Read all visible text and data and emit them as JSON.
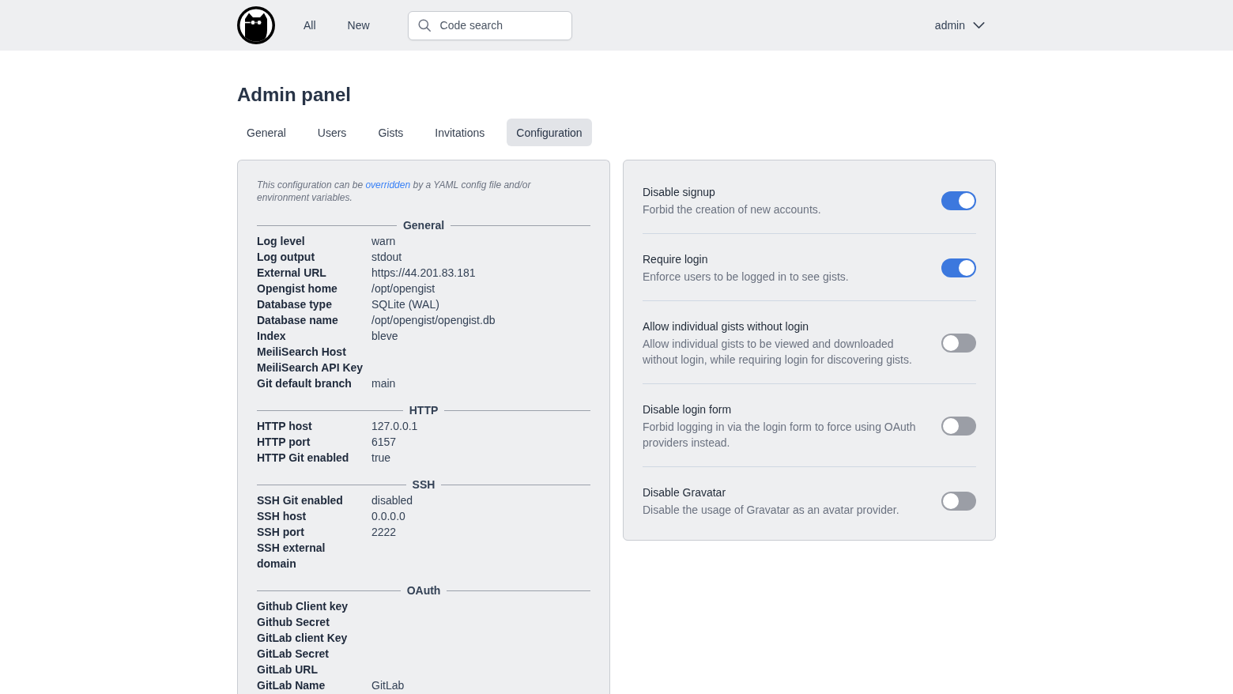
{
  "header": {
    "nav": [
      {
        "label": "All"
      },
      {
        "label": "New"
      }
    ],
    "search": {
      "placeholder": "Code search"
    },
    "user_menu": {
      "label": "admin"
    }
  },
  "page": {
    "title": "Admin panel"
  },
  "tabs": [
    {
      "label": "General",
      "selected": false
    },
    {
      "label": "Users",
      "selected": false
    },
    {
      "label": "Gists",
      "selected": false
    },
    {
      "label": "Invitations",
      "selected": false
    },
    {
      "label": "Configuration",
      "selected": true
    }
  ],
  "config_panel": {
    "note": {
      "before": "This configuration can be",
      "link": "overridden",
      "after": "by a YAML config file and/or environment variables."
    },
    "sections": [
      {
        "title": "General",
        "rows": [
          {
            "label": "Log level",
            "value": "warn"
          },
          {
            "label": "Log output",
            "value": "stdout"
          },
          {
            "label": "External URL",
            "value": "https://44.201.83.181"
          },
          {
            "label": "Opengist home",
            "value": "/opt/opengist"
          },
          {
            "label": "Database type",
            "value": "SQLite (WAL)"
          },
          {
            "label": "Database name",
            "value": "/opt/opengist/opengist.db"
          },
          {
            "label": "Index",
            "value": "bleve"
          },
          {
            "label": "MeiliSearch Host"
          },
          {
            "label": "MeiliSearch API Key"
          },
          {
            "label": "Git default branch",
            "value": "main"
          }
        ]
      },
      {
        "title": "HTTP",
        "rows": [
          {
            "label": "HTTP host",
            "value": "127.0.0.1"
          },
          {
            "label": "HTTP port",
            "value": "6157"
          },
          {
            "label": "HTTP Git enabled",
            "value": "true"
          }
        ]
      },
      {
        "title": "SSH",
        "rows": [
          {
            "label": "SSH Git enabled",
            "value": "disabled"
          },
          {
            "label": "SSH host",
            "value": "0.0.0.0"
          },
          {
            "label": "SSH port",
            "value": "2222"
          },
          {
            "label": "SSH external domain"
          }
        ]
      },
      {
        "title": "OAuth",
        "rows": [
          {
            "label": "Github Client key"
          },
          {
            "label": "Github Secret"
          },
          {
            "label": "GitLab client Key"
          },
          {
            "label": "GitLab Secret"
          },
          {
            "label": "GitLab URL"
          },
          {
            "label": "GitLab Name",
            "value": "GitLab"
          }
        ]
      }
    ]
  },
  "settings": [
    {
      "title": "Disable signup",
      "description": "Forbid the creation of new accounts.",
      "on": true
    },
    {
      "title": "Require login",
      "description": "Enforce users to be logged in to see gists.",
      "on": true
    },
    {
      "title": "Allow individual gists without login",
      "description": "Allow individual gists to be viewed and downloaded without login, while requiring login for discovering gists.",
      "on": false
    },
    {
      "title": "Disable login form",
      "description": "Forbid logging in via the login form to force using OAuth providers instead.",
      "on": false
    },
    {
      "title": "Disable Gravatar",
      "description": "Disable the usage of Gravatar as an avatar provider.",
      "on": false
    }
  ]
}
